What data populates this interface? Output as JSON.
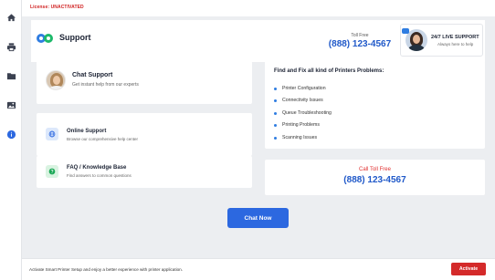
{
  "license": {
    "text": "License: UNACTIVATED"
  },
  "sidebar": {
    "items": [
      {
        "icon": "home-icon"
      },
      {
        "icon": "printer-icon"
      },
      {
        "icon": "folder-icon"
      },
      {
        "icon": "image-icon"
      },
      {
        "icon": "info-icon",
        "active": true
      }
    ]
  },
  "header": {
    "title": "Support",
    "tollfree_label": "Toll Free",
    "tollfree_number": "(888) 123-4567",
    "live_support_title": "24/7 LIVE SUPPORT",
    "live_support_sub": "Always here to help"
  },
  "cards": {
    "chat": {
      "title": "Chat Support",
      "subtitle": "Get instant help from our experts"
    },
    "online": {
      "title": "Online Support",
      "subtitle": "Browse our comprehensive help center",
      "icon": "globe-icon"
    },
    "faq": {
      "title": "FAQ / Knowledge Base",
      "subtitle": "Find answers to common questions",
      "icon": "question-icon"
    }
  },
  "problems": {
    "title": "Find and Fix all kind of Printers Problems:",
    "items": [
      "Printer Configuration",
      "Connectivity Issues",
      "Queue Troubleshooting",
      "Printing Problems",
      "Scanning Issues"
    ]
  },
  "call_toll": {
    "label": "Call Toll Free",
    "number": "(888) 123-4567"
  },
  "chat_now": {
    "label": "Chat Now"
  },
  "footer": {
    "text": "Activate Smart Printer Setup and enjoy a better experience with printer application.",
    "activate_label": "Activate"
  },
  "colors": {
    "accent": "#2c68e0",
    "danger": "#d42a2a",
    "phone_blue": "#2059c9",
    "background": "#eceef1"
  }
}
